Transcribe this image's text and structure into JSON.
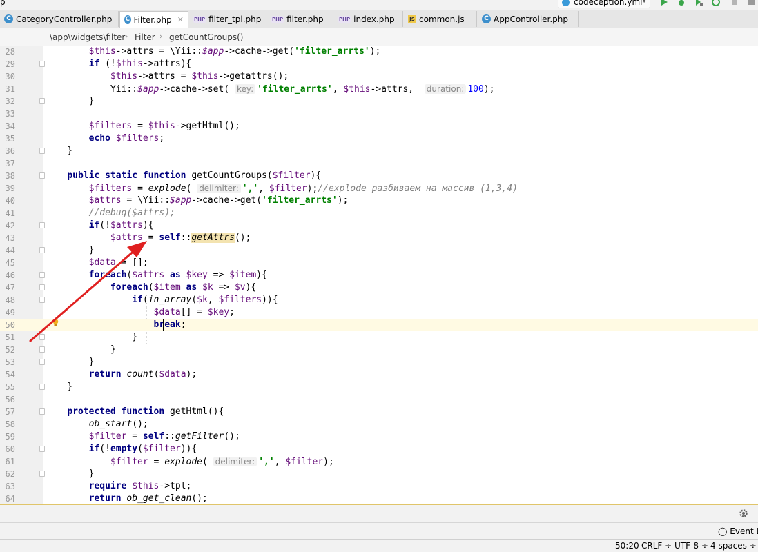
{
  "window": {
    "title_fragment": "p"
  },
  "toolbar": {
    "run_config": "codeception.yml",
    "run_config_icon": "codeception-icon"
  },
  "tabs": [
    {
      "label": "CategoryController.php",
      "icon": "class-icon"
    },
    {
      "label": "Filter.php",
      "icon": "class-icon",
      "active": true
    },
    {
      "label": "filter_tpl.php",
      "icon": "php-file-icon"
    },
    {
      "label": "filter.php",
      "icon": "php-file-icon"
    },
    {
      "label": "index.php",
      "icon": "php-file-icon"
    },
    {
      "label": "common.js",
      "icon": "js-file-icon"
    },
    {
      "label": "AppController.php",
      "icon": "class-icon"
    }
  ],
  "breadcrumb": {
    "path": "\\app\\widgets\\filter",
    "class": "Filter",
    "method": "getCountGroups()"
  },
  "editor": {
    "line_numbers": [
      "28",
      "29",
      "30",
      "31",
      "32",
      "33",
      "34",
      "35",
      "36",
      "37",
      "38",
      "39",
      "40",
      "41",
      "42",
      "43",
      "44",
      "45",
      "46",
      "47",
      "48",
      "49",
      "50",
      "51",
      "52",
      "53",
      "54",
      "55",
      "56",
      "57",
      "58",
      "59",
      "60",
      "61",
      "62",
      "63",
      "64"
    ],
    "current_line": "50",
    "hints": {
      "key": "key:",
      "duration": "duration:",
      "delimiter": "delimiter:"
    },
    "comments": {
      "explode": "//explode разбиваем на массив (1,3,4)",
      "debug": "//debug($attrs);"
    },
    "strings": {
      "filter_arrts": "'filter_arrts'",
      "comma": "','"
    },
    "numbers": {
      "duration": "100"
    }
  },
  "status_bar": {
    "position": "50:20",
    "line_sep": "CRLF",
    "encoding": "UTF-8",
    "indent": "4 spaces",
    "event_log": "Event Lo"
  },
  "colors": {
    "annotation_arrow": "#e02020",
    "keyword": "#000080",
    "variable": "#660e7a",
    "string": "#008000"
  }
}
